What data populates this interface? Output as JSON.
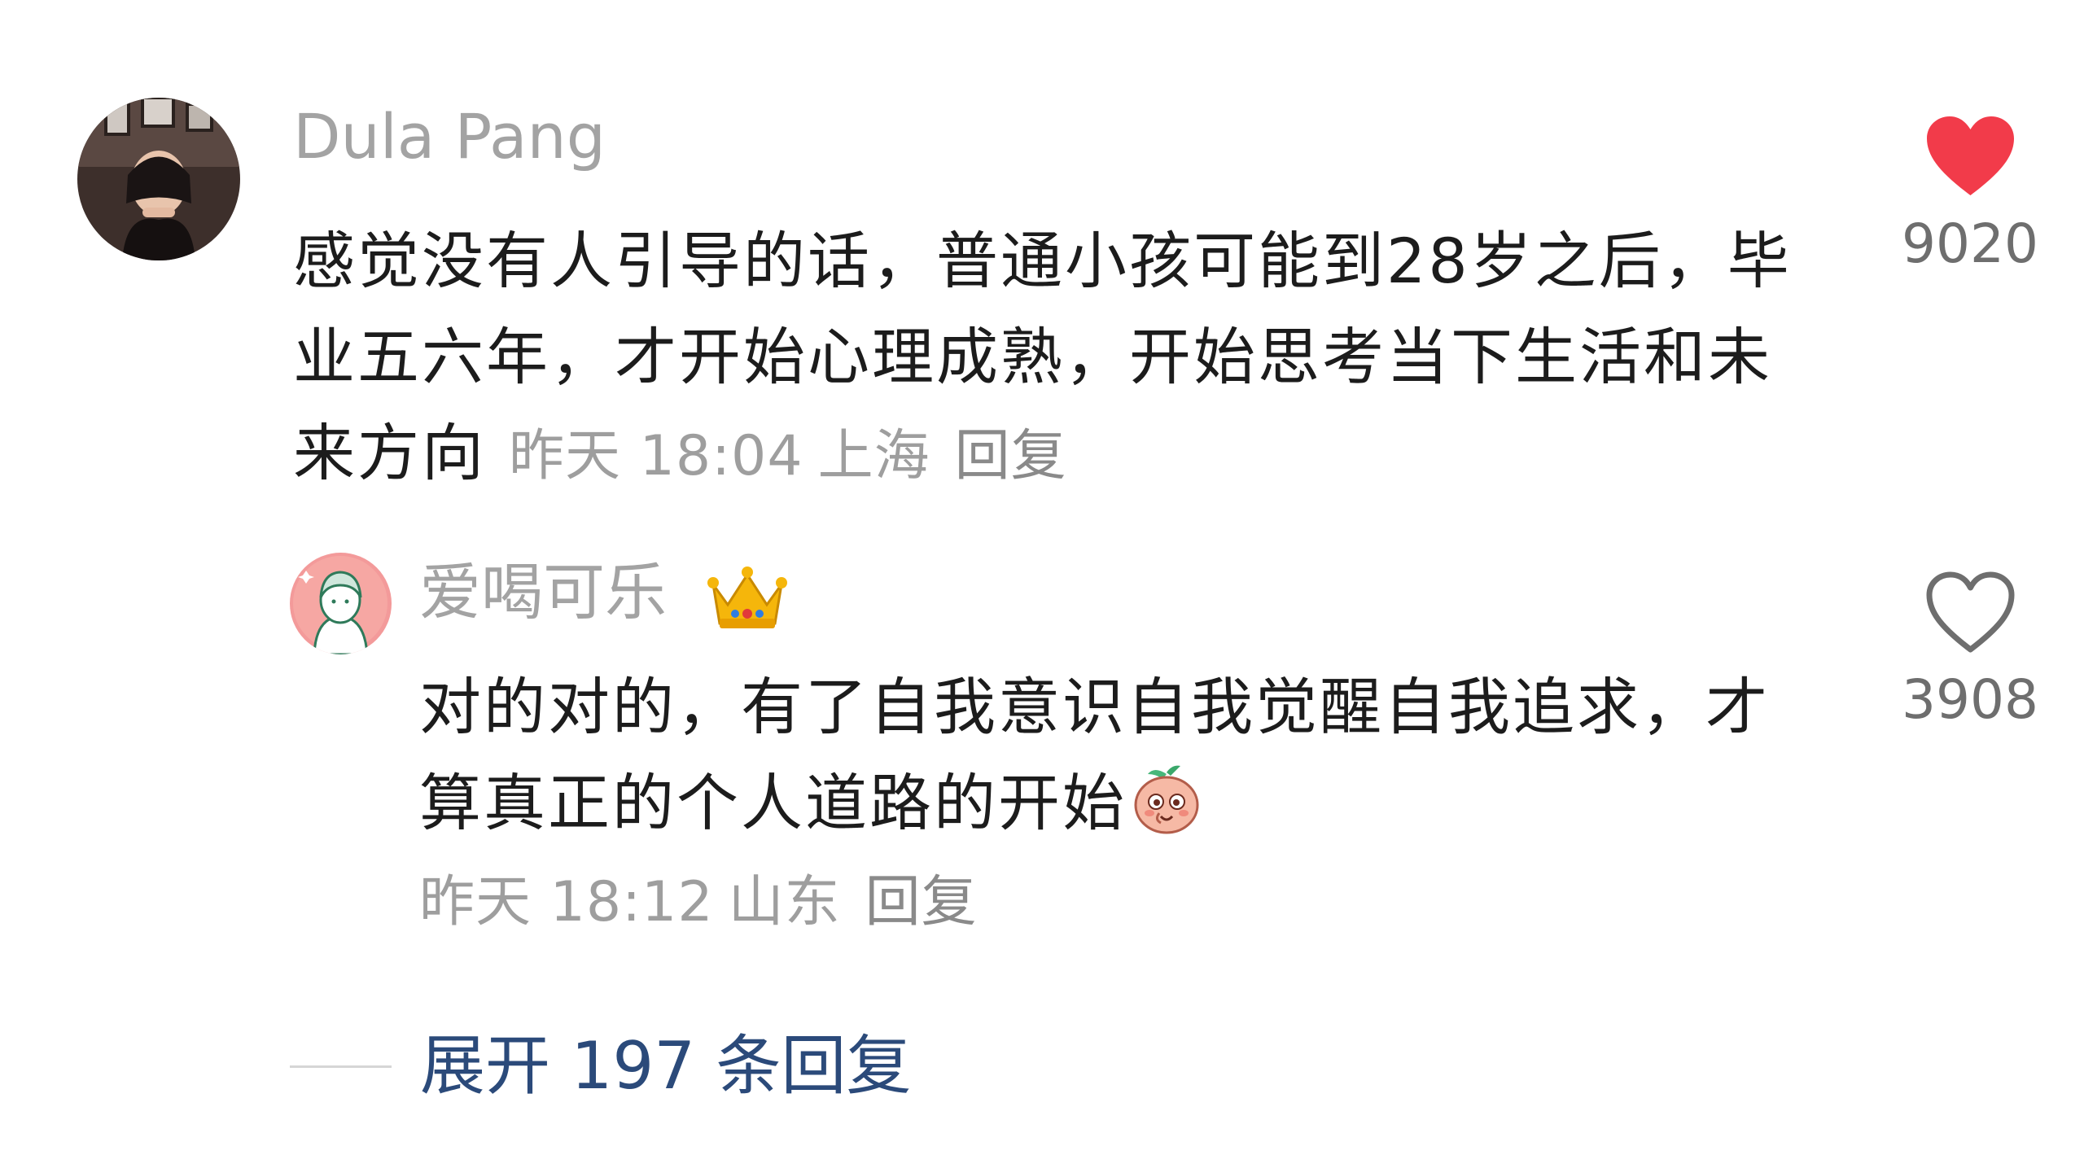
{
  "comment": {
    "username": "Dula Pang",
    "body": "感觉没有人引导的话，普通小孩可能到28岁之后，毕业五六年，才开始心理成熟，开始思考当下生活和未来方向",
    "time": "昨天 18:04",
    "location": "上海",
    "reply_label": "回复",
    "like_count": "9020",
    "liked": true,
    "like_color": "#f23b4a"
  },
  "reply": {
    "username": "爱喝可乐",
    "badge_icon": "crown-icon",
    "body": "对的对的，有了自我意识自我觉醒自我追求，才算真正的个人道路的开始",
    "emoji_icon": "peach-face-emoji-icon",
    "time": "昨天 18:12",
    "location": "山东",
    "reply_label": "回复",
    "like_count": "3908",
    "liked": false
  },
  "expand": {
    "label": "展开 197 条回复",
    "color": "#2b4a7a"
  }
}
